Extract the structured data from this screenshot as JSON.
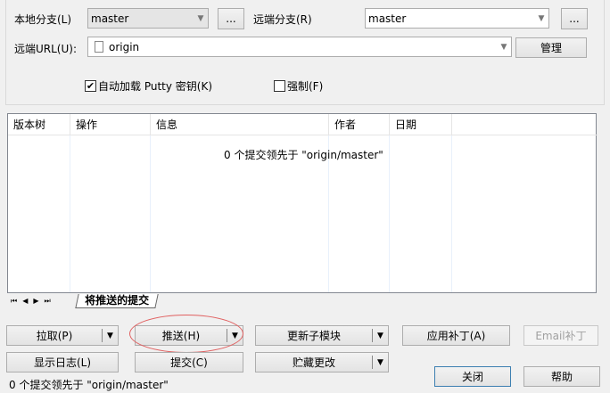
{
  "local_branch": {
    "label": "本地分支(L)",
    "value": "master",
    "browse": "..."
  },
  "remote_branch": {
    "label": "远端分支(R)",
    "value": "master",
    "browse": "..."
  },
  "remote_url": {
    "label": "远端URL(U):",
    "value": "origin",
    "manage": "管理"
  },
  "autoload_putty": {
    "label": "自动加载 Putty 密钥(K)",
    "checked": true
  },
  "force": {
    "label": "强制(F)",
    "checked": false
  },
  "table": {
    "columns": [
      "版本树",
      "操作",
      "信息",
      "作者",
      "日期"
    ],
    "message": "0 个提交领先于 \"origin/master\""
  },
  "tab": {
    "label": "将推送的提交"
  },
  "buttons": {
    "pull": "拉取(P)",
    "push": "推送(H)",
    "submodule": "更新子模块",
    "apply_patch": "应用补丁(A)",
    "email_patch": "Email补丁",
    "show_log": "显示日志(L)",
    "commit": "提交(C)",
    "stash": "贮藏更改",
    "close": "关闭",
    "help": "帮助"
  },
  "status": "0 个提交领先于 \"origin/master\""
}
